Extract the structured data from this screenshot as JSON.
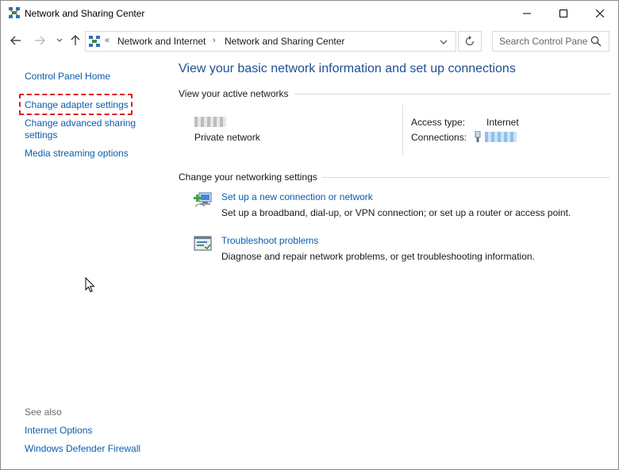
{
  "window": {
    "title": "Network and Sharing Center"
  },
  "navigation": {
    "breadcrumbs": [
      "Network and Internet",
      "Network and Sharing Center"
    ],
    "breadcrumb_overflow": "«",
    "separator": "›",
    "search_placeholder": "Search Control Panel"
  },
  "left_pane": {
    "links": [
      "Control Panel Home",
      "Change adapter settings",
      "Change advanced sharing",
      "settings",
      "Media streaming options"
    ],
    "highlighted_item": "Change adapter settings",
    "see_also": {
      "heading": "See also",
      "links": [
        "Internet Options",
        "Windows Defender Firewall"
      ]
    }
  },
  "main": {
    "title": "View your basic network information and set up connections",
    "active_networks": {
      "heading": "View your active networks",
      "network_type": "Private network",
      "access_type_label": "Access type:",
      "access_type_value": "Internet",
      "connections_label": "Connections:"
    },
    "networking_settings": {
      "heading": "Change your networking settings",
      "tasks": [
        {
          "link": "Set up a new connection or network",
          "description": "Set up a broadband, dial-up, or VPN connection; or set up a router or access point.",
          "icon": "new-connection-icon"
        },
        {
          "link": "Troubleshoot problems",
          "description": "Diagnose and repair network problems, or get troubleshooting information.",
          "icon": "troubleshoot-icon"
        }
      ]
    }
  },
  "colors": {
    "link": "#0b5cad",
    "title": "#1e4f93",
    "highlight_border": "#e0141e"
  }
}
